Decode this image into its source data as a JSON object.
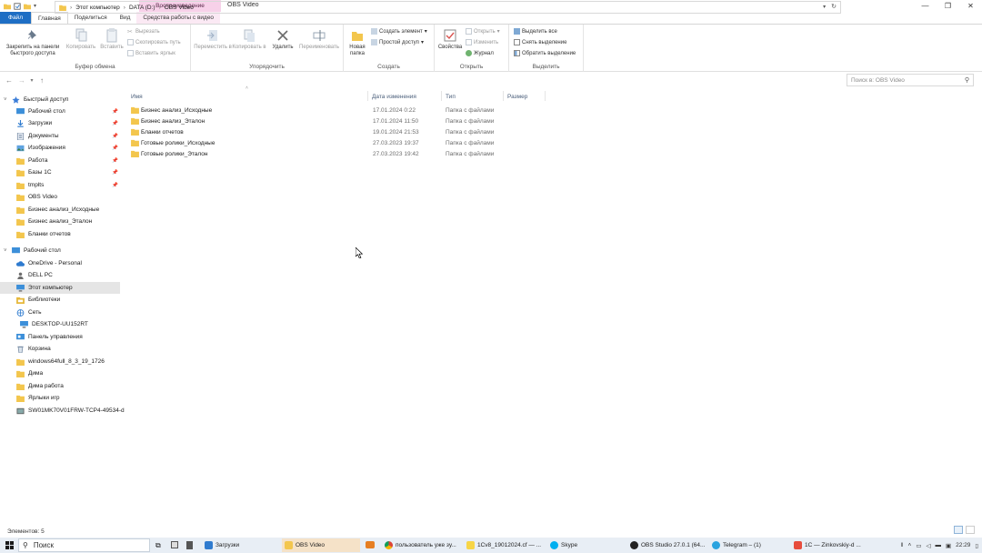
{
  "window": {
    "context_tab_header": "Воспроизведение",
    "title": "OBS Video",
    "controls": [
      "—",
      "❐",
      "✕"
    ]
  },
  "tabs": [
    {
      "label": "Файл"
    },
    {
      "label": "Главная"
    },
    {
      "label": "Поделиться"
    },
    {
      "label": "Вид"
    },
    {
      "label": "Средства работы с видео"
    }
  ],
  "ribbon": {
    "clipboard": {
      "pin_label": "Закрепить на панели быстрого доступа",
      "copy_label": "Копировать",
      "paste_label": "Вставить",
      "cut_label": "Вырезать",
      "copy_path_label": "Скопировать путь",
      "paste_shortcut_label": "Вставить ярлык",
      "group_label": "Буфер обмена"
    },
    "organize": {
      "move_label": "Переместить в",
      "copy_to_label": "Копировать в",
      "delete_label": "Удалить",
      "rename_label": "Переименовать",
      "group_label": "Упорядочить"
    },
    "new": {
      "new_folder_label": "Новая папка",
      "new_item_label": "Создать элемент",
      "easy_access_label": "Простой доступ",
      "group_label": "Создать"
    },
    "open": {
      "properties_label": "Свойства",
      "open_label": "Открыть",
      "edit_label": "Изменить",
      "history_label": "Журнал",
      "group_label": "Открыть"
    },
    "select": {
      "select_all_label": "Выделить все",
      "select_none_label": "Снять выделение",
      "invert_label": "Обратить выделение",
      "group_label": "Выделить"
    }
  },
  "address": {
    "crumbs": [
      "Этот компьютер",
      "DATA (D:)",
      "OBS Video"
    ],
    "search_placeholder": "Поиск в: OBS Video"
  },
  "nav_pane": {
    "quick_access": "Быстрый доступ",
    "items": [
      {
        "label": "Рабочий стол",
        "pinned": true
      },
      {
        "label": "Загрузки",
        "pinned": true
      },
      {
        "label": "Документы",
        "pinned": true
      },
      {
        "label": "Изображения",
        "pinned": true
      },
      {
        "label": "Работа",
        "pinned": true
      },
      {
        "label": "Базы 1С",
        "pinned": true
      },
      {
        "label": "tmplts",
        "pinned": true
      },
      {
        "label": "OBS Video",
        "pinned": false
      },
      {
        "label": "Бизнес анализ_Исходные",
        "pinned": false
      },
      {
        "label": "Бизнес анализ_Эталон",
        "pinned": false
      },
      {
        "label": "Бланки отчетов",
        "pinned": false
      }
    ],
    "desktop": "Рабочий стол",
    "desktop_items": [
      "OneDrive - Personal",
      "DELL PC",
      "Этот компьютер",
      "Библиотеки",
      "Сеть",
      "DESKTOP-UU152RT",
      "Панель управления",
      "Корзина",
      "windows64full_8_3_19_1726",
      "Дима",
      "Дима работа",
      "Ярлыки игр",
      "SW01MK70V01FRW-TCP4-49534-d"
    ]
  },
  "columns": {
    "name": "Имя",
    "date": "Дата изменения",
    "type": "Тип",
    "size": "Размер"
  },
  "files": [
    {
      "name": "Бизнес анализ_Исходные",
      "date": "17.01.2024 0:22",
      "type": "Папка с файлами"
    },
    {
      "name": "Бизнес анализ_Эталон",
      "date": "17.01.2024 11:50",
      "type": "Папка с файлами"
    },
    {
      "name": "Бланки отчетов",
      "date": "19.01.2024 21:53",
      "type": "Папка с файлами"
    },
    {
      "name": "Готовые ролики_Исходные",
      "date": "27.03.2023 19:37",
      "type": "Папка с файлами"
    },
    {
      "name": "Готовые ролики_Эталон",
      "date": "27.03.2023 19:42",
      "type": "Папка с файлами"
    }
  ],
  "status": {
    "count": "Элементов: 5"
  },
  "taskbar": {
    "search": "Поиск",
    "apps": [
      {
        "label": "Загрузки"
      },
      {
        "label": "OBS Video"
      },
      {
        "label": "пользователь уже зу..."
      },
      {
        "label": "1Cv8_19012024.cf — ..."
      },
      {
        "label": "Skype"
      },
      {
        "label": "OBS Studio 27.0.1 (64..."
      },
      {
        "label": "Telegram – (1)"
      },
      {
        "label": "1C — Zinkovskiy-d ..."
      }
    ],
    "time": "22:29"
  },
  "colors": {
    "file_tab": "#1e6ec4",
    "context_tab": "#f7d1e9",
    "folder": "#f3c64d",
    "selection": "#e5e5e5"
  }
}
